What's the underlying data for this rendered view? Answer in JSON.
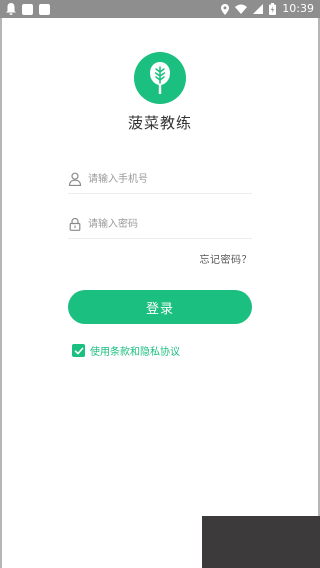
{
  "status_bar": {
    "time": "10:39"
  },
  "app": {
    "name": "菠菜教练"
  },
  "login_form": {
    "phone_placeholder": "请输入手机号",
    "password_placeholder": "请输入密码",
    "forgot_password": "忘记密码？",
    "login_button": "登录",
    "agreement_text": "使用条款和隐私协议",
    "agreement_checked": true
  },
  "colors": {
    "accent": "#1bbf7f",
    "status_bar": "#8e8e8e"
  }
}
